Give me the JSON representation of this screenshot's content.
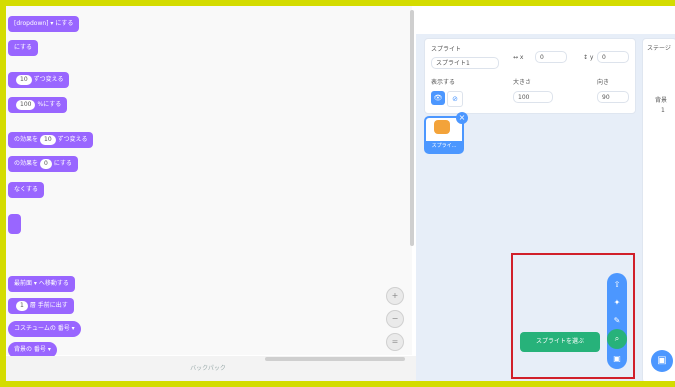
{
  "blocks": [
    {
      "text": "[dropdown] ▾  にする"
    },
    {
      "text": "にする"
    },
    {
      "text_a": "",
      "oval": "10",
      "text_b": "ずつ変える"
    },
    {
      "text_a": "",
      "oval": "100",
      "text_b": "%にする"
    },
    {
      "text_a": "の効果を",
      "oval": "10",
      "text_b": "ずつ変える"
    },
    {
      "text_a": "の効果を",
      "oval": "0",
      "text_b": "にする"
    },
    {
      "text": "なくする"
    },
    {
      "text": ""
    },
    {
      "text": "最前面 ▾ へ移動する"
    },
    {
      "text_a": "",
      "oval": "1",
      "text_b": "層 手前に出す"
    },
    {
      "text": "コスチュームの 番号 ▾"
    },
    {
      "text": "背景の 番号 ▾"
    }
  ],
  "bottom_strip": "バックパック",
  "zoom": {
    "in": "+",
    "out": "−",
    "reset": "="
  },
  "sprite_info": {
    "sprite_label": "スプライト",
    "sprite_name": "スプライト1",
    "x_label": "↔ x",
    "x_value": "0",
    "y_label": "↕ y",
    "y_value": "0",
    "show_label": "表示する",
    "size_label": "大きさ",
    "size_value": "100",
    "direction_label": "向き",
    "direction_value": "90"
  },
  "stage_panel": {
    "title": "ステージ",
    "backdrop_label": "背景",
    "backdrop_count": "1"
  },
  "sprite_thumb": {
    "label": "スプライ..."
  },
  "choose_sprite": "スプライトを選ぶ",
  "menu_icons": [
    "upload-icon",
    "surprise-icon",
    "paint-icon",
    "search-icon",
    "cat-icon"
  ],
  "colors": {
    "highlight": "#d11f2a",
    "accent": "#4c97ff",
    "looks": "#9966ff",
    "green": "#27b27a",
    "frame": "#d4dc00"
  }
}
